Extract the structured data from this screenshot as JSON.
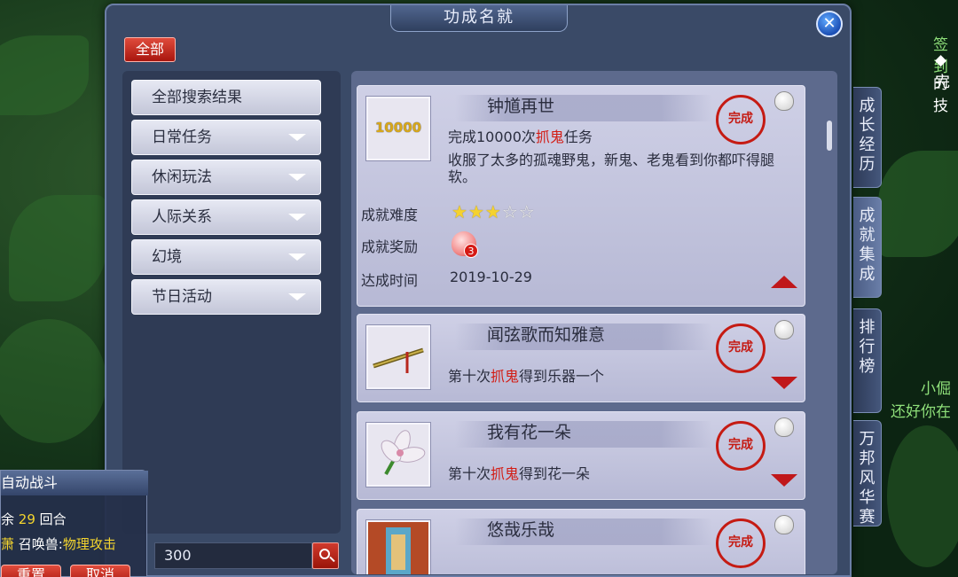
{
  "window": {
    "title": "功成名就",
    "close_label": "✕"
  },
  "filter": {
    "all_label": "全部"
  },
  "categories": [
    {
      "label": "全部搜索结果",
      "expandable": false
    },
    {
      "label": "日常任务",
      "expandable": true
    },
    {
      "label": "休闲玩法",
      "expandable": true
    },
    {
      "label": "人际关系",
      "expandable": true
    },
    {
      "label": "幻境",
      "expandable": true
    },
    {
      "label": "节日活动",
      "expandable": true
    }
  ],
  "search": {
    "value": "300"
  },
  "achievements": [
    {
      "title": "钟馗再世",
      "thumb_text": "10000",
      "desc_prefix": "完成10000次",
      "desc_red": "抓鬼",
      "desc_suffix": "任务",
      "flavor": "收服了太多的孤魂野鬼，新鬼、老鬼看到你都吓得腿软。",
      "seal": "完成",
      "expanded": true,
      "difficulty_label": "成就难度",
      "difficulty_stars": 3,
      "difficulty_max": 5,
      "reward_label": "成就奖励",
      "reward_count": "3",
      "date_label": "达成时间",
      "date": "2019-10-29"
    },
    {
      "title": "闻弦歌而知雅意",
      "desc_prefix": "第十次",
      "desc_red": "抓鬼",
      "desc_suffix": "得到乐器一个",
      "seal": "完成",
      "expanded": false
    },
    {
      "title": "我有花一朵",
      "desc_prefix": "第十次",
      "desc_red": "抓鬼",
      "desc_suffix": "得到花一朵",
      "seal": "完成",
      "expanded": false
    },
    {
      "title": "悠哉乐哉",
      "seal": "完成",
      "expanded": false
    }
  ],
  "side_tabs": [
    "成长经历",
    "成就集成",
    "排行榜",
    "万邦风华赛"
  ],
  "battle": {
    "title": "自动战斗",
    "rounds_prefix": "余",
    "rounds_value": "29",
    "rounds_suffix": "回合",
    "summon_left": "萧",
    "summon_label": "召唤兽:",
    "summon_value": "物理攻击",
    "reset_label": "重置",
    "cancel_label": "取消"
  },
  "hud": {
    "top_right_1": "签到",
    "top_right_2": "◆完",
    "top_right_3": "的技",
    "chat_1": "小倔",
    "chat_2": "还好你在"
  },
  "colors": {
    "red_text": "#d31c14",
    "seal_red": "#c51b13",
    "star_on": "#f5d22e",
    "hud_green": "#8fe07a"
  }
}
